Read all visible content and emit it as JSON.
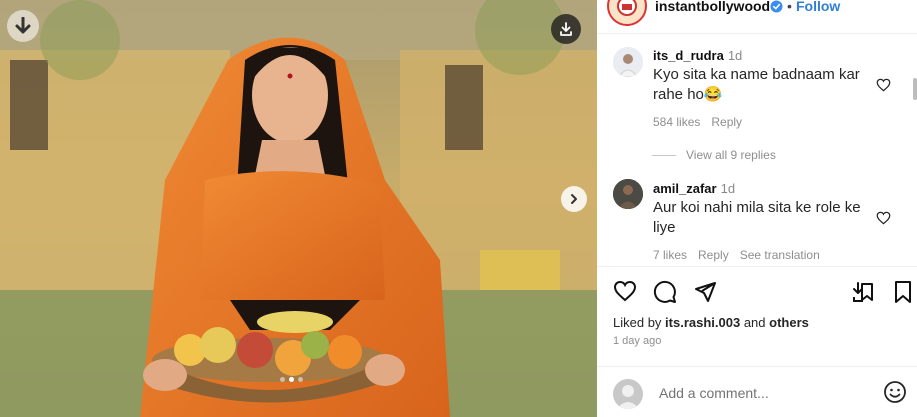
{
  "post": {
    "account": "instantbollywood",
    "follow_label": "Follow",
    "separator": "•"
  },
  "comments": [
    {
      "username": "its_d_rudra",
      "time": "1d",
      "text": "Kyo sita ka name badnaam kar rahe ho😂",
      "likes": "584 likes",
      "reply_label": "Reply"
    },
    {
      "username": "amil_zafar",
      "time": "1d",
      "text": "Aur koi nahi mila sita ke role ke liye",
      "likes": "7 likes",
      "reply_label": "Reply",
      "translate_label": "See translation"
    }
  ],
  "view_replies": "View all 9 replies",
  "likes_summary": {
    "prefix": "Liked by",
    "user": "its.rashi.003",
    "middle": "and",
    "suffix": "others"
  },
  "posted_ago": "1 day ago",
  "add_comment": {
    "placeholder": "Add a comment..."
  },
  "carousel": {
    "slide_count": 3,
    "active_index": 1
  },
  "colors": {
    "follow": "#2f7fd6",
    "verified": "#3b8ef0",
    "saree": "#e8782a"
  },
  "icons": [
    "download-arrow-icon",
    "download-icon",
    "chevron-right-icon",
    "verified-badge-icon",
    "heart-icon",
    "comment-icon",
    "share-icon",
    "save-to-collection-icon",
    "bookmark-icon",
    "emoji-icon"
  ]
}
